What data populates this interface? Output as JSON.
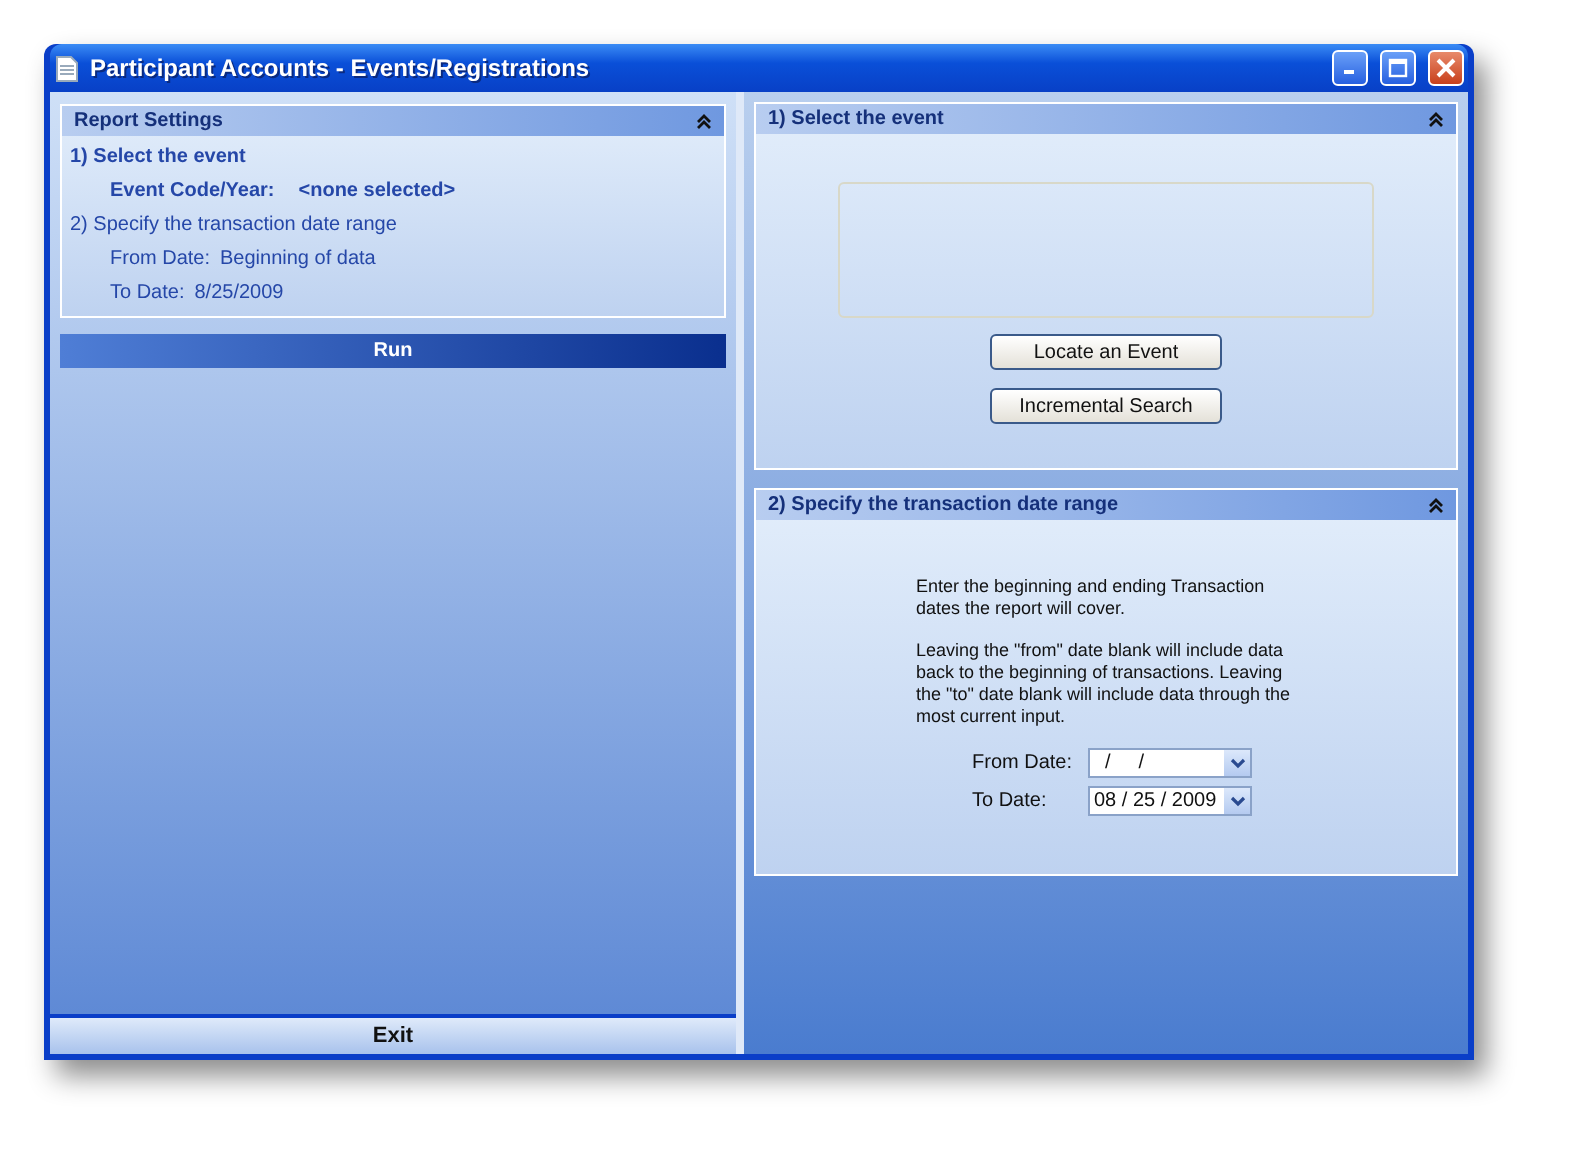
{
  "window": {
    "title": "Participant Accounts - Events/Registrations"
  },
  "report_settings": {
    "title": "Report Settings",
    "expanded": true,
    "lines": [
      {
        "kind": "step",
        "text": "1)  Select the event",
        "active": true
      },
      {
        "kind": "detail",
        "label": "Event Code/Year:",
        "value": "<none selected>",
        "active": true
      },
      {
        "kind": "step",
        "text": "2)  Specify the transaction date range",
        "active": false
      },
      {
        "kind": "detail",
        "label": "From Date:",
        "value": "Beginning of data",
        "active": false
      },
      {
        "kind": "detail",
        "label": "To Date:",
        "value": "8/25/2009",
        "active": false
      }
    ]
  },
  "run_button": "Run",
  "exit_button": "Exit",
  "sections": [
    {
      "kind": "event",
      "title": "1)  Select the event",
      "expanded": true,
      "buttons": [
        "Locate an Event",
        "Incremental Search"
      ]
    },
    {
      "kind": "dates",
      "title": "2)  Specify the transaction date range",
      "expanded": true,
      "paragraphs": [
        "Enter the beginning and ending Transaction dates the report will cover.",
        "Leaving the \"from\" date blank will include data back to the beginning of transactions. Leaving the \"to\" date blank will include data through the most current input."
      ],
      "fields": [
        {
          "label": "From Date:",
          "value": "  /     /"
        },
        {
          "label": "To Date:",
          "value": "08 / 25 / 2009"
        }
      ]
    }
  ]
}
